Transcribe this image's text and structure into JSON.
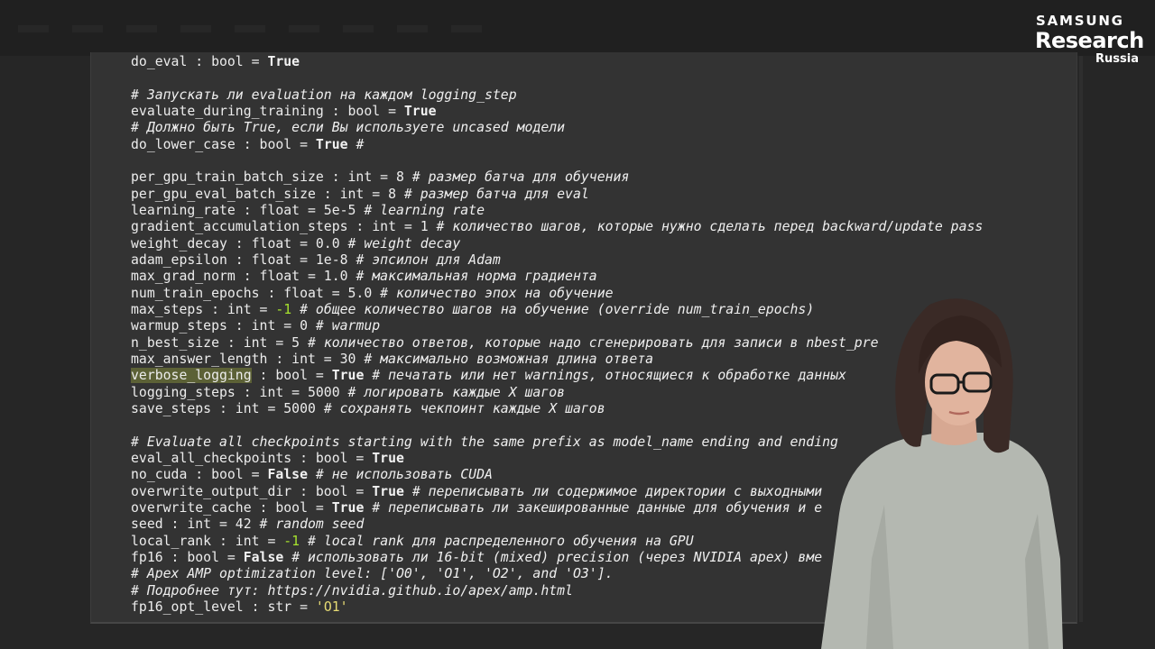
{
  "logo": {
    "brand": "SAMSUNG",
    "name": "Research",
    "region": "Russia"
  },
  "code_lines": [
    [
      [
        "do_eval : bool = ",
        ""
      ],
      [
        "True",
        "kw"
      ]
    ],
    [],
    [
      [
        "# Запускать ли evaluation на каждом logging_step",
        "cmt"
      ]
    ],
    [
      [
        "evaluate_during_training : bool = ",
        ""
      ],
      [
        "True",
        "kw"
      ]
    ],
    [
      [
        "# Должно быть True, если Вы используете uncased модели",
        "cmt"
      ]
    ],
    [
      [
        "do_lower_case : bool = ",
        ""
      ],
      [
        "True",
        "kw"
      ],
      [
        " #",
        "cmt"
      ]
    ],
    [],
    [
      [
        "per_gpu_train_batch_size : int = 8 ",
        ""
      ],
      [
        "# размер батча для обучения",
        "cmt"
      ]
    ],
    [
      [
        "per_gpu_eval_batch_size : int = 8 ",
        ""
      ],
      [
        "# размер батча для eval",
        "cmt"
      ]
    ],
    [
      [
        "learning_rate : float = 5e-5 ",
        ""
      ],
      [
        "# learning rate",
        "cmt"
      ]
    ],
    [
      [
        "gradient_accumulation_steps : int = 1 ",
        ""
      ],
      [
        "# количество шагов, которые нужно сделать перед backward/update pass",
        "cmt"
      ]
    ],
    [
      [
        "weight_decay : float = 0.0 ",
        ""
      ],
      [
        "# weight decay",
        "cmt"
      ]
    ],
    [
      [
        "adam_epsilon : float = 1e-8 ",
        ""
      ],
      [
        "# эпсилон для Adam",
        "cmt"
      ]
    ],
    [
      [
        "max_grad_norm : float = 1.0 ",
        ""
      ],
      [
        "# максимальная норма градиента",
        "cmt"
      ]
    ],
    [
      [
        "num_train_epochs : float = 5.0 ",
        ""
      ],
      [
        "# количество эпох на обучение",
        "cmt"
      ]
    ],
    [
      [
        "max_steps : int = ",
        ""
      ],
      [
        "-1",
        "neg"
      ],
      [
        " ",
        ""
      ],
      [
        "# общее количество шагов на обучение (override num_train_epochs)",
        "cmt"
      ]
    ],
    [
      [
        "warmup_steps : int = 0 ",
        ""
      ],
      [
        "# warmup",
        "cmt"
      ]
    ],
    [
      [
        "n_best_size : int = 5 ",
        ""
      ],
      [
        "# количество ответов, которые надо сгенерировать для записи в nbest_pre",
        "cmt"
      ]
    ],
    [
      [
        "max_answer_length : int = 30 ",
        ""
      ],
      [
        "# максимально возможная длина ответа",
        "cmt"
      ]
    ],
    [
      [
        "verbose_logging",
        "hl"
      ],
      [
        " : bool = ",
        ""
      ],
      [
        "True",
        "kw"
      ],
      [
        " ",
        ""
      ],
      [
        "# печатать или нет warnings, относящиеся к обработке данных",
        "cmt"
      ]
    ],
    [
      [
        "logging_steps : int = 5000 ",
        ""
      ],
      [
        "# логировать каждые X шагов",
        "cmt"
      ]
    ],
    [
      [
        "save_steps : int = 5000 ",
        ""
      ],
      [
        "# сохранять чекпоинт каждые X шагов",
        "cmt"
      ]
    ],
    [],
    [
      [
        "# Evaluate all checkpoints starting with the same prefix as model_name ending and ending",
        "cmt"
      ]
    ],
    [
      [
        "eval_all_checkpoints : bool = ",
        ""
      ],
      [
        "True",
        "kw"
      ]
    ],
    [
      [
        "no_cuda : bool = ",
        ""
      ],
      [
        "False",
        "kw"
      ],
      [
        " ",
        ""
      ],
      [
        "# не использовать CUDA",
        "cmt"
      ]
    ],
    [
      [
        "overwrite_output_dir : bool = ",
        ""
      ],
      [
        "True",
        "kw"
      ],
      [
        " ",
        ""
      ],
      [
        "# переписывать ли содержимое директории с выходными",
        "cmt"
      ]
    ],
    [
      [
        "overwrite_cache : bool = ",
        ""
      ],
      [
        "True",
        "kw"
      ],
      [
        " ",
        ""
      ],
      [
        "# переписывать ли закешированные данные для обучения и e",
        "cmt"
      ]
    ],
    [
      [
        "seed : int = 42 ",
        ""
      ],
      [
        "# random seed",
        "cmt"
      ]
    ],
    [
      [
        "local_rank : int = ",
        ""
      ],
      [
        "-1",
        "neg"
      ],
      [
        " ",
        ""
      ],
      [
        "# local rank для распределенного обучения на GPU",
        "cmt"
      ]
    ],
    [
      [
        "fp16 : bool = ",
        ""
      ],
      [
        "False",
        "kw"
      ],
      [
        " ",
        ""
      ],
      [
        "# использовать ли 16-bit (mixed) precision (через NVIDIA apex) вме",
        "cmt"
      ]
    ],
    [
      [
        "# Apex AMP optimization level: ['O0', 'O1', 'O2', and 'O3'].",
        "cmt"
      ]
    ],
    [
      [
        "# Подробнее тут: https://nvidia.github.io/apex/amp.html",
        "cmt"
      ]
    ],
    [
      [
        "fp16_opt_level : str = ",
        ""
      ],
      [
        "'O1'",
        "str"
      ]
    ]
  ],
  "colors": {
    "background": "#262626",
    "panel": "#333333",
    "code_text": "#ececec",
    "highlight": "#5c6136",
    "negative_number": "#a6e22e",
    "string": "#e6db74"
  }
}
